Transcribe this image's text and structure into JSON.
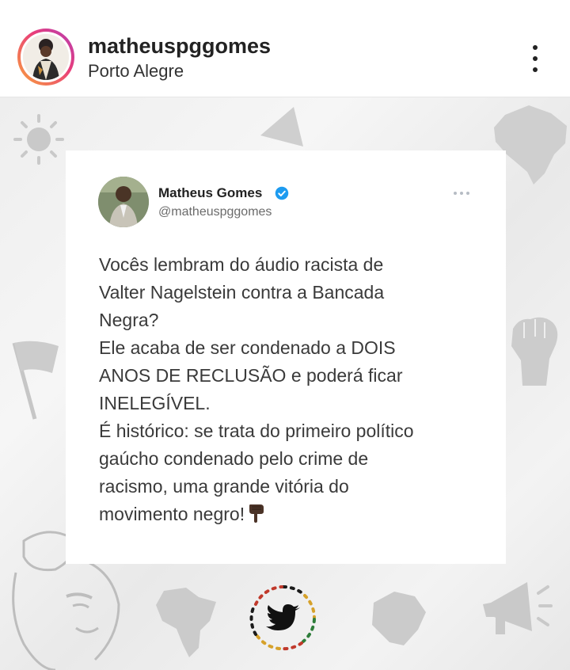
{
  "header": {
    "username": "matheuspggomes",
    "location": "Porto Alegre",
    "more_icon": "more-vertical-icon"
  },
  "tweet": {
    "name": "Matheus Gomes",
    "handle": "@matheuspggomes",
    "verified_icon": "verified-badge-icon",
    "more_icon": "more-horizontal-icon",
    "lines": [
      "Vocês lembram do áudio racista de",
      "Valter Nagelstein contra a Bancada",
      "Negra?",
      "Ele acaba de ser condenado a DOIS",
      "ANOS DE RECLUSÃO e poderá ficar",
      "INELEGÍVEL.",
      "É histórico: se trata do primeiro político",
      "gaúcho condenado pelo crime de",
      "racismo, uma grande vitória do",
      "movimento negro!"
    ],
    "emoji_icon": "pointing-down-hand-icon"
  },
  "footer": {
    "logo_icon": "twitter-bird-icon"
  },
  "colors": {
    "verified": "#1d9bf0",
    "story_ring_start": "#f9a43b",
    "story_ring_end": "#b23fb6",
    "background": "#eeeeee"
  }
}
